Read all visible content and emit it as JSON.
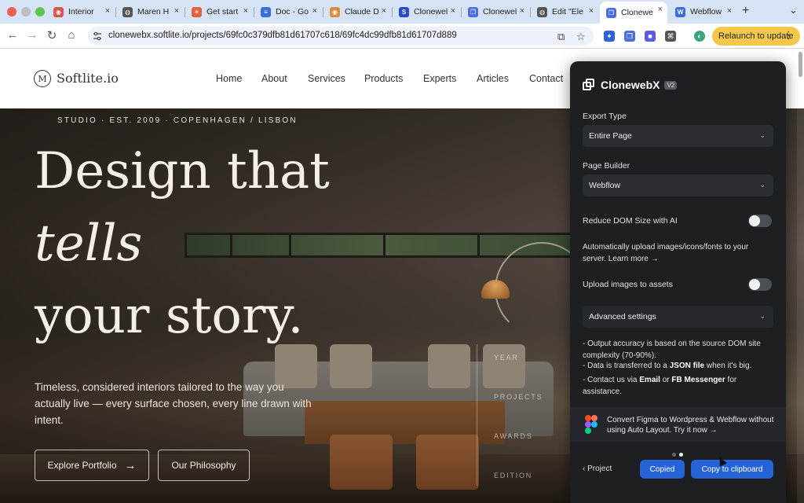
{
  "browser": {
    "tabs": [
      {
        "title": "Interior",
        "color": "#d9534f",
        "glyph": "◉"
      },
      {
        "title": "Maren H",
        "color": "#555555",
        "glyph": "◍"
      },
      {
        "title": "Get start",
        "color": "#e0613b",
        "glyph": "✳"
      },
      {
        "title": "Doc - Go",
        "color": "#3b6fd8",
        "glyph": "≡"
      },
      {
        "title": "Claude D",
        "color": "#e08a3b",
        "glyph": "◉"
      },
      {
        "title": "Clonewel",
        "color": "#2c47c7",
        "glyph": "S"
      },
      {
        "title": "Clonewel",
        "color": "#4a6ee0",
        "glyph": "❐"
      },
      {
        "title": "Edit \"Ele",
        "color": "#555555",
        "glyph": "◍"
      },
      {
        "title": "Clonewe",
        "color": "#4a6ee0",
        "glyph": "❐"
      },
      {
        "title": "Webflow",
        "color": "#3b6fd8",
        "glyph": "W"
      }
    ],
    "close_glyph": "×",
    "new_tab": "+",
    "tab_search": "⌄",
    "url": "clonewebx.softlite.io/projects/69fc0c379dfb81d61707c618/69fc4dc99dfb81d61707d889",
    "relaunch_label": "Relaunch to update",
    "menu_glyph": "⋮",
    "nav": {
      "back": "←",
      "forward": "→",
      "reload": "↻",
      "home": "⌂"
    },
    "omni_icons": {
      "install": "⧉",
      "bookmark": "☆"
    },
    "extension_colors": [
      "#2c63d6",
      "#4a6ee0",
      "#5b5be8",
      "#555555",
      "#3aa57a"
    ],
    "extension_glyphs": [
      "✦",
      "❐",
      "■",
      "⌘",
      "◐"
    ]
  },
  "site": {
    "logo_mark": "M",
    "logo_text": "Softlite.io",
    "nav": [
      "Home",
      "About",
      "Services",
      "Products",
      "Experts",
      "Articles",
      "Contact"
    ],
    "eyebrow": "STUDIO · EST. 2009 · COPENHAGEN / LISBON",
    "headline": {
      "line1": "Design that",
      "line2": "tells",
      "line3": "your story."
    },
    "lead": "Timeless, considered interiors tailored to the way you actually live — every surface chosen, every line drawn with intent.",
    "cta_primary": "Explore Portfolio",
    "cta_arrow": "→",
    "cta_secondary": "Our Philosophy",
    "stats": [
      "YEAR",
      "PROJECTS",
      "AWARDS",
      "EDITION"
    ]
  },
  "panel": {
    "title": "ClonewebX",
    "badge": "V2",
    "export_type_label": "Export Type",
    "export_type_value": "Entire Page",
    "page_builder_label": "Page Builder",
    "page_builder_value": "Webflow",
    "reduce_dom_label": "Reduce DOM Size with AI",
    "auto_upload_text": "Automatically upload images/icons/fonts to your server. Learn more →",
    "upload_assets_label": "Upload images to assets",
    "advanced_label": "Advanced settings",
    "chevron": "⌄",
    "note1": "- Output accuracy is based on the source DOM site complexity (70-90%).",
    "note2_pre": "- Data is transferred to a ",
    "note2_bold": "JSON file",
    "note2_post": " when it's big.",
    "note3_pre": "- Contact us via ",
    "note3_b1": "Email",
    "note3_mid": " or ",
    "note3_b2": "FB Messenger",
    "note3_post": " for assistance.",
    "promo": "Convert Figma to Wordpress & Webflow without using Auto Layout. Try it now →",
    "back": "‹ Project",
    "copied": "Copied",
    "copy_clipboard": "Copy to clipboard",
    "accent": "#2563d6"
  }
}
